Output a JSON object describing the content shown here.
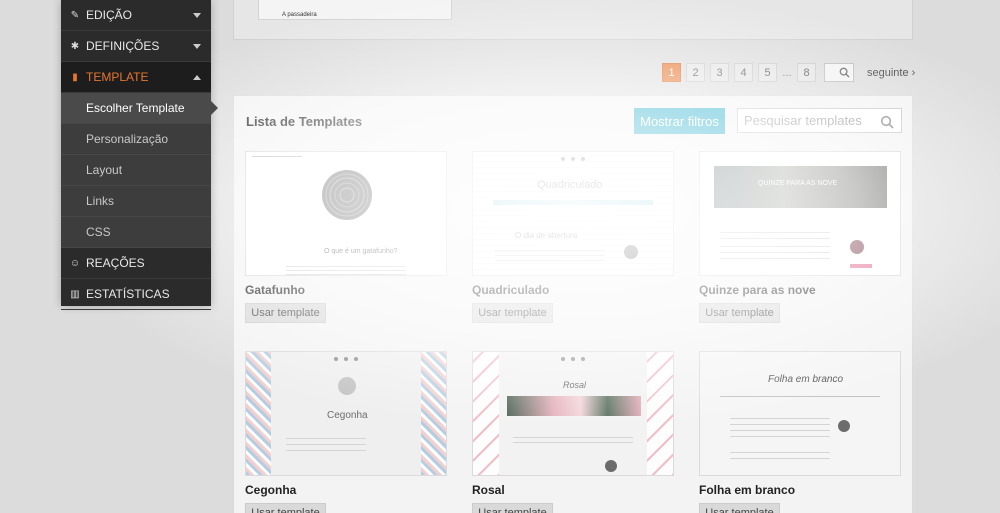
{
  "sidebar": {
    "items": [
      {
        "label": "EDIÇÃO",
        "icon": "edit-icon"
      },
      {
        "label": "DEFINIÇÕES",
        "icon": "gear-icon"
      },
      {
        "label": "TEMPLATE",
        "icon": "file-icon"
      }
    ],
    "subitems": [
      {
        "label": "Escolher Template"
      },
      {
        "label": "Personalização"
      },
      {
        "label": "Layout"
      },
      {
        "label": "Links"
      },
      {
        "label": "CSS"
      }
    ],
    "bottom_items": [
      {
        "label": "REAÇÕES",
        "icon": "smiley-icon"
      },
      {
        "label": "ESTATÍSTICAS",
        "icon": "bar-chart-icon"
      }
    ]
  },
  "top_card": {
    "label": "A passadeira"
  },
  "pagination": {
    "pages": [
      "1",
      "2",
      "3",
      "4",
      "5",
      "8"
    ],
    "current": "1",
    "ellipsis": "...",
    "next_label": "seguinte ›"
  },
  "panel": {
    "title": "Lista de Templates",
    "filter_button": "Mostrar filtros",
    "search_placeholder": "Pesquisar templates"
  },
  "templates": [
    {
      "name": "Gatafunho",
      "use_label": "Usar template",
      "thumb_title": "O que é um gatafunho?"
    },
    {
      "name": "Quadriculado",
      "use_label": "Usar template",
      "thumb_title": "Quadriculado",
      "thumb_post": "O dia de abertura"
    },
    {
      "name": "Quinze para as nove",
      "use_label": "Usar template",
      "thumb_title": "QUINZE PARA AS NOVE"
    },
    {
      "name": "Cegonha",
      "use_label": "Usar template",
      "thumb_title": "Cegonha"
    },
    {
      "name": "Rosal",
      "use_label": "Usar template",
      "thumb_title": "Rosal"
    },
    {
      "name": "Folha em branco",
      "use_label": "Usar template",
      "thumb_title": "Folha em branco"
    }
  ],
  "colors": {
    "accent": "#e8762d",
    "button": "#19a9c9",
    "sidebar": "#2b2b2b"
  }
}
